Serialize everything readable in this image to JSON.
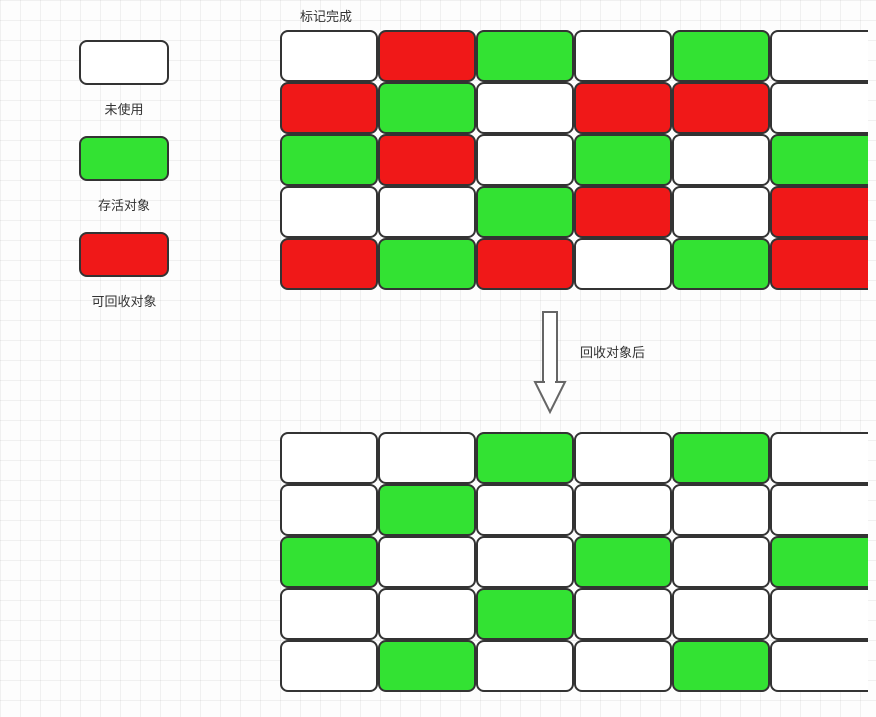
{
  "legend": {
    "unused": "未使用",
    "alive": "存活对象",
    "recyclable": "可回收对象"
  },
  "labels": {
    "mark_done": "标记完成",
    "after_reclaim": "回收对象后"
  },
  "colors": {
    "unused": "white",
    "alive": "green",
    "recyclable": "red"
  },
  "column_count": 6,
  "grid_before": [
    [
      "white",
      "red",
      "green",
      "white",
      "green",
      "white"
    ],
    [
      "red",
      "green",
      "white",
      "red",
      "red",
      "white"
    ],
    [
      "green",
      "red",
      "white",
      "green",
      "white",
      "green"
    ],
    [
      "white",
      "white",
      "green",
      "red",
      "white",
      "red"
    ],
    [
      "red",
      "green",
      "red",
      "white",
      "green",
      "red"
    ]
  ],
  "grid_after": [
    [
      "white",
      "white",
      "green",
      "white",
      "green",
      "white"
    ],
    [
      "white",
      "green",
      "white",
      "white",
      "white",
      "white"
    ],
    [
      "green",
      "white",
      "white",
      "green",
      "white",
      "green"
    ],
    [
      "white",
      "white",
      "green",
      "white",
      "white",
      "white"
    ],
    [
      "white",
      "green",
      "white",
      "white",
      "green",
      "white"
    ]
  ]
}
